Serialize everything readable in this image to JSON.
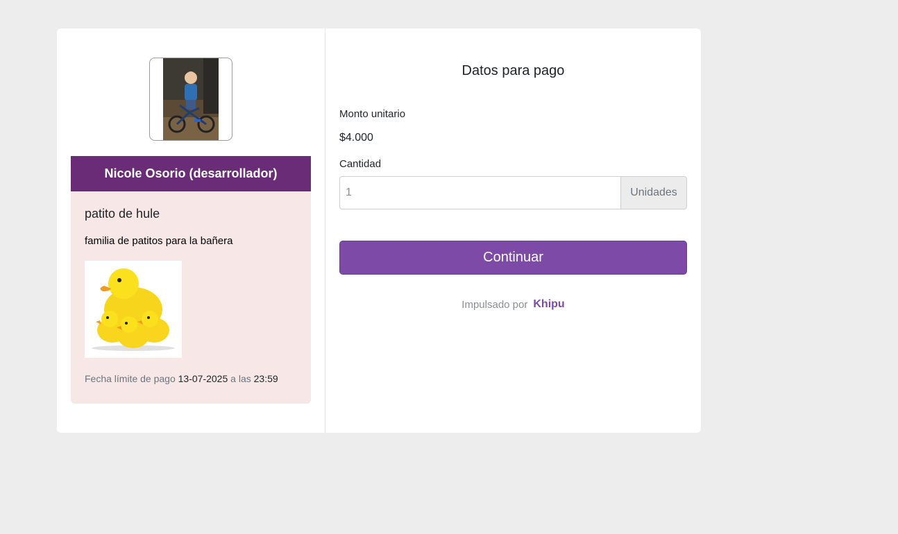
{
  "merchant": {
    "name": "Nicole Osorio (desarrollador)",
    "avatar_icon": "boy-on-bicycle-photo"
  },
  "product": {
    "name": "patito de hule",
    "description": "familia de patitos para la bañera",
    "image_icon": "rubber-ducks-photo",
    "deadline_label": "Fecha límite de pago",
    "deadline_date": "13-07-2025",
    "deadline_connector": "a las",
    "deadline_time": "23:59"
  },
  "payment": {
    "title": "Datos para pago",
    "unit_amount_label": "Monto unitario",
    "unit_amount": "$4.000",
    "quantity_label": "Cantidad",
    "quantity_placeholder": "1",
    "quantity_unit": "Unidades",
    "continue_label": "Continuar",
    "powered_by": "Impulsado por",
    "brand": "Khipu"
  },
  "colors": {
    "merchant_bar": "#6a2c77",
    "product_bg": "#f7e7e6",
    "primary_button": "#7d4aa8",
    "page_bg": "#ededed"
  }
}
